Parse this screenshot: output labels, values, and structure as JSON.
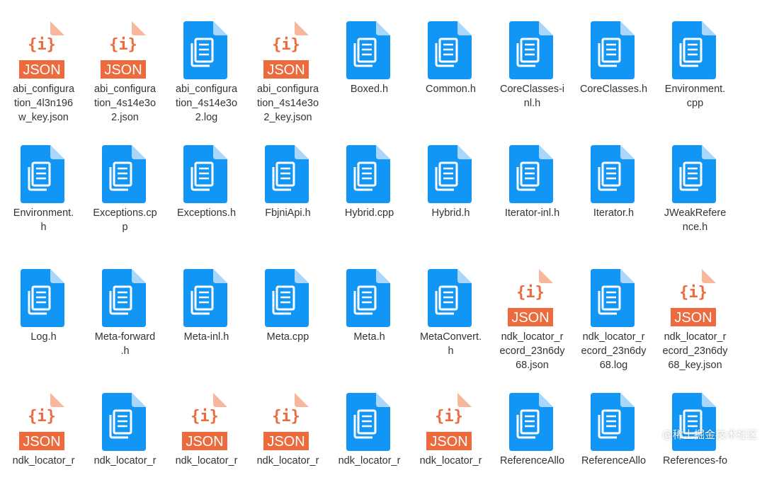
{
  "colors": {
    "doc_icon": "#1296F5",
    "doc_fold": "#A9D6FB",
    "json_badge": "#EC6A3B",
    "json_fold": "#F6B79C",
    "label_text": "#333333"
  },
  "files": [
    {
      "name": "abi_configuration_4l3n196w_key.json",
      "icon": "json-file-icon",
      "lines": [
        "abi_configura",
        "tion_4l3n196",
        "w_key.json"
      ]
    },
    {
      "name": "abi_configuration_4s14e3o2.json",
      "icon": "json-file-icon",
      "lines": [
        "abi_configura",
        "tion_4s14e3o",
        "2.json"
      ]
    },
    {
      "name": "abi_configuration_4s14e3o2.log",
      "icon": "document-icon",
      "lines": [
        "abi_configura",
        "tion_4s14e3o",
        "2.log"
      ]
    },
    {
      "name": "abi_configuration_4s14e3o2_key.json",
      "icon": "json-file-icon",
      "lines": [
        "abi_configura",
        "tion_4s14e3o",
        "2_key.json"
      ]
    },
    {
      "name": "Boxed.h",
      "icon": "document-icon",
      "lines": [
        "Boxed.h"
      ]
    },
    {
      "name": "Common.h",
      "icon": "document-icon",
      "lines": [
        "Common.h"
      ]
    },
    {
      "name": "CoreClasses-inl.h",
      "icon": "document-icon",
      "lines": [
        "CoreClasses-i",
        "nl.h"
      ]
    },
    {
      "name": "CoreClasses.h",
      "icon": "document-icon",
      "lines": [
        "CoreClasses.h"
      ]
    },
    {
      "name": "Environment.cpp",
      "icon": "document-icon",
      "lines": [
        "Environment.",
        "cpp"
      ]
    },
    {
      "name": "Environment.h",
      "icon": "document-icon",
      "lines": [
        "Environment.",
        "h"
      ]
    },
    {
      "name": "Exceptions.cpp",
      "icon": "document-icon",
      "lines": [
        "Exceptions.cp",
        "p"
      ]
    },
    {
      "name": "Exceptions.h",
      "icon": "document-icon",
      "lines": [
        "Exceptions.h"
      ]
    },
    {
      "name": "FbjniApi.h",
      "icon": "document-icon",
      "lines": [
        "FbjniApi.h"
      ]
    },
    {
      "name": "Hybrid.cpp",
      "icon": "document-icon",
      "lines": [
        "Hybrid.cpp"
      ]
    },
    {
      "name": "Hybrid.h",
      "icon": "document-icon",
      "lines": [
        "Hybrid.h"
      ]
    },
    {
      "name": "Iterator-inl.h",
      "icon": "document-icon",
      "lines": [
        "Iterator-inl.h"
      ]
    },
    {
      "name": "Iterator.h",
      "icon": "document-icon",
      "lines": [
        "Iterator.h"
      ]
    },
    {
      "name": "JWeakReference.h",
      "icon": "document-icon",
      "lines": [
        "JWeakRefere",
        "nce.h"
      ]
    },
    {
      "name": "Log.h",
      "icon": "document-icon",
      "lines": [
        "Log.h"
      ]
    },
    {
      "name": "Meta-forward.h",
      "icon": "document-icon",
      "lines": [
        "Meta-forward",
        ".h"
      ]
    },
    {
      "name": "Meta-inl.h",
      "icon": "document-icon",
      "lines": [
        "Meta-inl.h"
      ]
    },
    {
      "name": "Meta.cpp",
      "icon": "document-icon",
      "lines": [
        "Meta.cpp"
      ]
    },
    {
      "name": "Meta.h",
      "icon": "document-icon",
      "lines": [
        "Meta.h"
      ]
    },
    {
      "name": "MetaConvert.h",
      "icon": "document-icon",
      "lines": [
        "MetaConvert.",
        "h"
      ]
    },
    {
      "name": "ndk_locator_record_23n6dy68.json",
      "icon": "json-file-icon",
      "lines": [
        "ndk_locator_r",
        "ecord_23n6dy",
        "68.json"
      ]
    },
    {
      "name": "ndk_locator_record_23n6dy68.log",
      "icon": "document-icon",
      "lines": [
        "ndk_locator_r",
        "ecord_23n6dy",
        "68.log"
      ]
    },
    {
      "name": "ndk_locator_record_23n6dy68_key.json",
      "icon": "json-file-icon",
      "lines": [
        "ndk_locator_r",
        "ecord_23n6dy",
        "68_key.json"
      ]
    },
    {
      "name": "ndk_locator_r",
      "icon": "json-file-icon",
      "lines": [
        "ndk_locator_r"
      ]
    },
    {
      "name": "ndk_locator_r",
      "icon": "document-icon",
      "lines": [
        "ndk_locator_r"
      ]
    },
    {
      "name": "ndk_locator_r",
      "icon": "json-file-icon",
      "lines": [
        "ndk_locator_r"
      ]
    },
    {
      "name": "ndk_locator_r",
      "icon": "json-file-icon",
      "lines": [
        "ndk_locator_r"
      ]
    },
    {
      "name": "ndk_locator_r",
      "icon": "document-icon",
      "lines": [
        "ndk_locator_r"
      ]
    },
    {
      "name": "ndk_locator_r",
      "icon": "json-file-icon",
      "lines": [
        "ndk_locator_r"
      ]
    },
    {
      "name": "ReferenceAllo",
      "icon": "document-icon",
      "lines": [
        "ReferenceAllo"
      ]
    },
    {
      "name": "ReferenceAllo",
      "icon": "document-icon",
      "lines": [
        "ReferenceAllo"
      ]
    },
    {
      "name": "References-fo",
      "icon": "document-icon",
      "lines": [
        "References-fo"
      ]
    }
  ],
  "json_badge_text": "JSON",
  "json_brace_text": "{i}",
  "watermark": "@稀土掘金技术社区"
}
